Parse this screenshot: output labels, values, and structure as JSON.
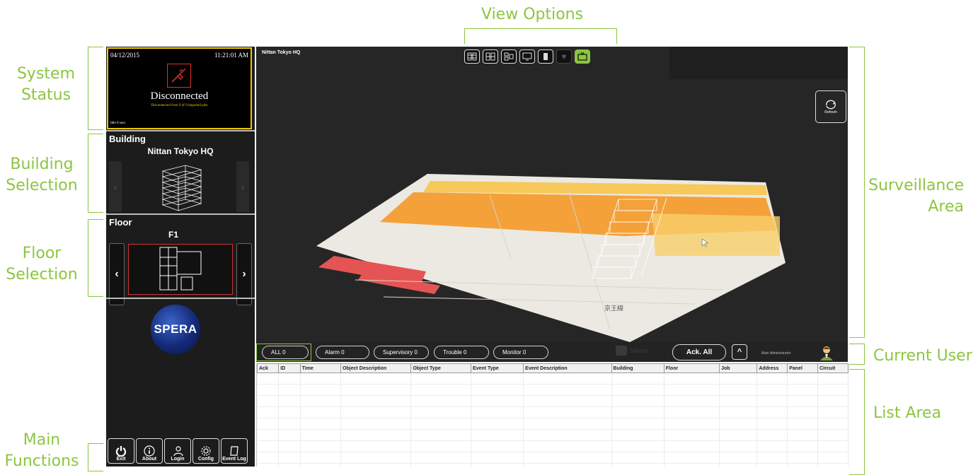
{
  "callouts": {
    "view_options": "View Options",
    "system_status": "System\nStatus",
    "building_selection": "Building\nSelection",
    "floor_selection": "Floor\nSelection",
    "main_functions": "Main\nFunctions",
    "surveillance_area": "Surveillance\nArea",
    "current_user": "Current User",
    "list_area": "List Area"
  },
  "status": {
    "date": "04/12/2015",
    "time": "11:21:01  AM",
    "state": "Disconnected",
    "detail": "Disconnected from 9 of 9 imported jobs",
    "idle": "Idle 0 secs"
  },
  "building": {
    "section_label": "Building",
    "name": "Nittan Tokyo HQ"
  },
  "floor": {
    "section_label": "Floor",
    "name": "F1",
    "prev": "‹",
    "next": "›"
  },
  "logo": {
    "text": "SPERA"
  },
  "surveillance": {
    "building_name": "Nittan Tokyo HQ",
    "refresh_label": "Refresh",
    "map_label": "京王線"
  },
  "filters": [
    {
      "label": "ALL   0"
    },
    {
      "label": "Alarm   0"
    },
    {
      "label": "Supervisory   0"
    },
    {
      "label": "Trouble   0"
    },
    {
      "label": "Monitor   0"
    }
  ],
  "actions": {
    "muted_label": "Silence",
    "ack_all": "Ack. All",
    "expand": "^"
  },
  "user": {
    "name": "Main Administrator"
  },
  "table": {
    "columns": [
      "Ack",
      "ID",
      "Time",
      "Object Description",
      "Object Type",
      "Event Type",
      "Event Description",
      "Building",
      "Floor",
      "Job",
      "Address",
      "Panel",
      "Circuit"
    ]
  },
  "main_functions": [
    {
      "label": "Exit",
      "icon": "power-icon"
    },
    {
      "label": "About",
      "icon": "info-icon"
    },
    {
      "label": "Login",
      "icon": "login-icon"
    },
    {
      "label": "Config",
      "icon": "gear-icon"
    },
    {
      "label": "Event Log",
      "icon": "event-log-icon"
    }
  ],
  "colors": {
    "accent": "#8cc63f",
    "status_border": "#f2c400",
    "disconnected": "#e03030",
    "panel_bg": "#1c1c1c",
    "map_orange": "#f4a13a"
  }
}
